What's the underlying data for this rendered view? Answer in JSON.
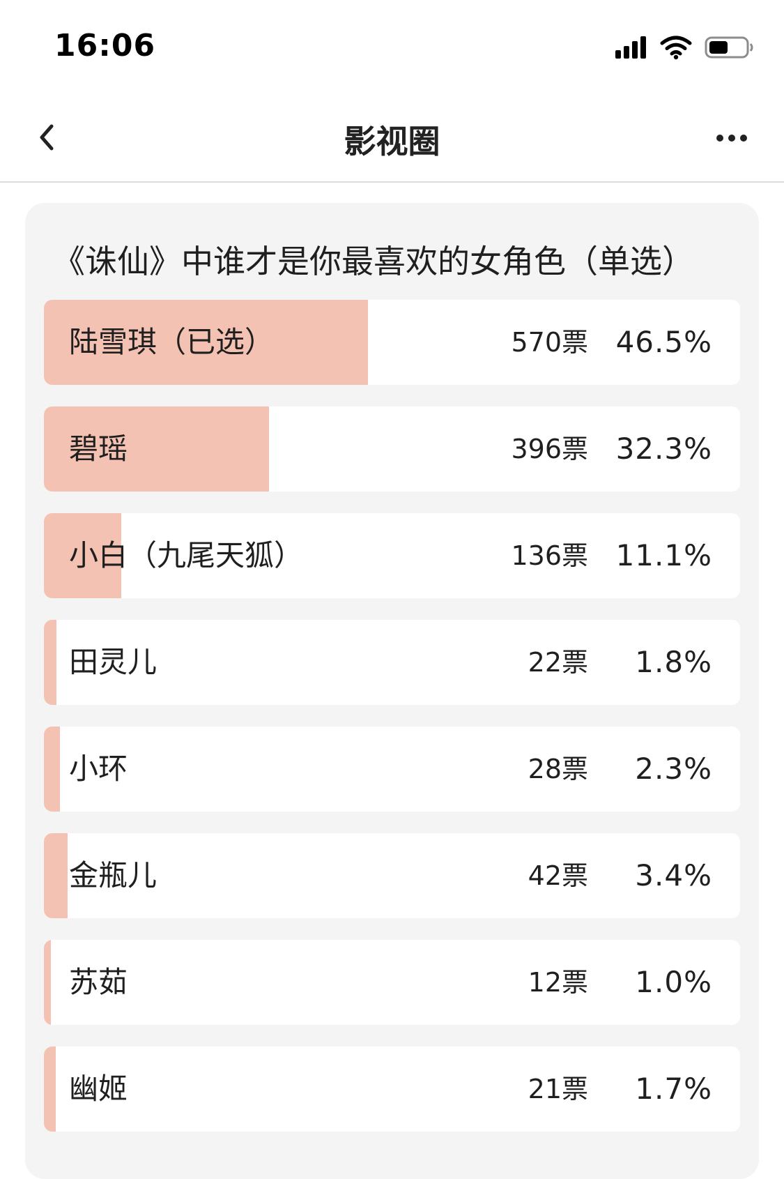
{
  "status_bar": {
    "time": "16:06",
    "icons": [
      "signal-icon",
      "wifi-icon",
      "battery-icon"
    ]
  },
  "nav": {
    "title": "影视圈",
    "back_icon": "chevron-left-icon",
    "more_icon": "more-dots-icon"
  },
  "poll": {
    "question": "《诛仙》中谁才是你最喜欢的女角色（单选）",
    "fill_color": "#f4c2b2",
    "options": [
      {
        "label": "陆雪琪（已选）",
        "votes": "570票",
        "percent": "46.5%",
        "fraction": 0.465
      },
      {
        "label": "碧瑶",
        "votes": "396票",
        "percent": "32.3%",
        "fraction": 0.323
      },
      {
        "label": "小白（九尾天狐）",
        "votes": "136票",
        "percent": "11.1%",
        "fraction": 0.111
      },
      {
        "label": "田灵儿",
        "votes": "22票",
        "percent": "1.8%",
        "fraction": 0.018
      },
      {
        "label": "小环",
        "votes": "28票",
        "percent": "2.3%",
        "fraction": 0.023
      },
      {
        "label": "金瓶儿",
        "votes": "42票",
        "percent": "3.4%",
        "fraction": 0.034
      },
      {
        "label": "苏茹",
        "votes": "12票",
        "percent": "1.0%",
        "fraction": 0.01
      },
      {
        "label": "幽姬",
        "votes": "21票",
        "percent": "1.7%",
        "fraction": 0.017
      }
    ]
  }
}
